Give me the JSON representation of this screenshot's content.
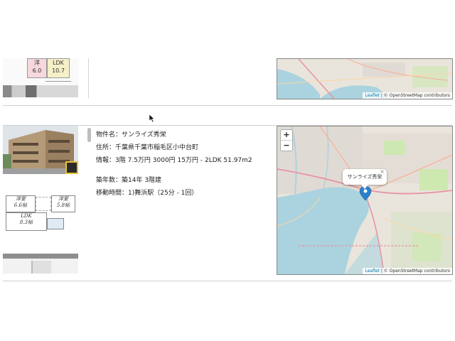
{
  "listing_previous": {
    "floorplan_rooms": [
      {
        "name": "洋",
        "size": "6.0"
      },
      {
        "name": "LDK",
        "size": "10.7"
      }
    ],
    "map": {
      "attribution_link": "Leaflet",
      "attribution_text": "| © OpenStreetMap contributors"
    }
  },
  "listing": {
    "name_label": "物件名：",
    "name_value": "サンライズ秀栄",
    "address_label": "住所：",
    "address_value": "千葉県千葉市稲毛区小中台町",
    "details_label": "情報：",
    "details_value": "3階 7.5万円 3000円 15万円 - 2LDK 51.97m2",
    "age_label": "築年数：",
    "age_value": "築14年 3階建",
    "commute_label": "移動時間：",
    "commute_value": "1)舞浜駅（25分 - 1回）",
    "floorplan_rooms": [
      {
        "name": "洋室",
        "size": "6.6帖"
      },
      {
        "name": "洋室",
        "size": "5.8帖"
      },
      {
        "name": "LDK",
        "size": "8.3帖"
      }
    ],
    "map": {
      "zoom_in": "+",
      "zoom_out": "−",
      "popup_label": "サンライズ秀栄",
      "popup_close": "×",
      "attribution_link": "Leaflet",
      "attribution_text": "| © OpenStreetMap contributors"
    }
  },
  "colors": {
    "sea": "#aad3df",
    "land": "#e9e5dc",
    "urban": "#e0dad4",
    "park": "#cde8b0",
    "marker": "#2a81cb",
    "link": "#0078a8"
  }
}
